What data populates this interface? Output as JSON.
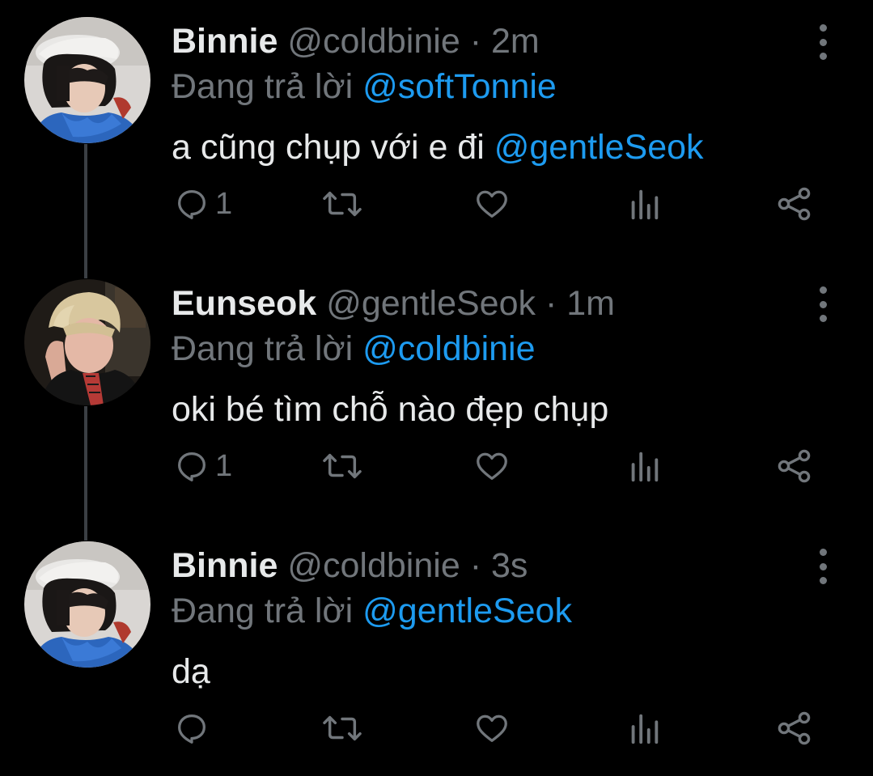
{
  "tweets": [
    {
      "name": "Binnie",
      "handle": "@coldbinie",
      "time": "2m",
      "reply_prefix": "Đang trả lời",
      "reply_to": "@softTonnie",
      "text": "a cũng chụp với e đi",
      "text_mention": "@gentleSeok",
      "reply_count": "1"
    },
    {
      "name": "Eunseok",
      "handle": "@gentleSeok",
      "time": "1m",
      "reply_prefix": "Đang trả lời",
      "reply_to": "@coldbinie",
      "text": "oki bé tìm chỗ nào đẹp chụp",
      "text_mention": "",
      "reply_count": "1"
    },
    {
      "name": "Binnie",
      "handle": "@coldbinie",
      "time": "3s",
      "reply_prefix": "Đang trả lời",
      "reply_to": "@gentleSeok",
      "text": "dạ",
      "text_mention": "",
      "reply_count": ""
    }
  ],
  "colors": {
    "background": "#000000",
    "text": "#e7e9ea",
    "secondary": "#71767b",
    "mention": "#1d9bf0",
    "thread_line": "#3b3f44"
  },
  "icons": [
    "reply-icon",
    "retweet-icon",
    "like-icon",
    "views-icon",
    "share-icon",
    "more-options-icon"
  ]
}
